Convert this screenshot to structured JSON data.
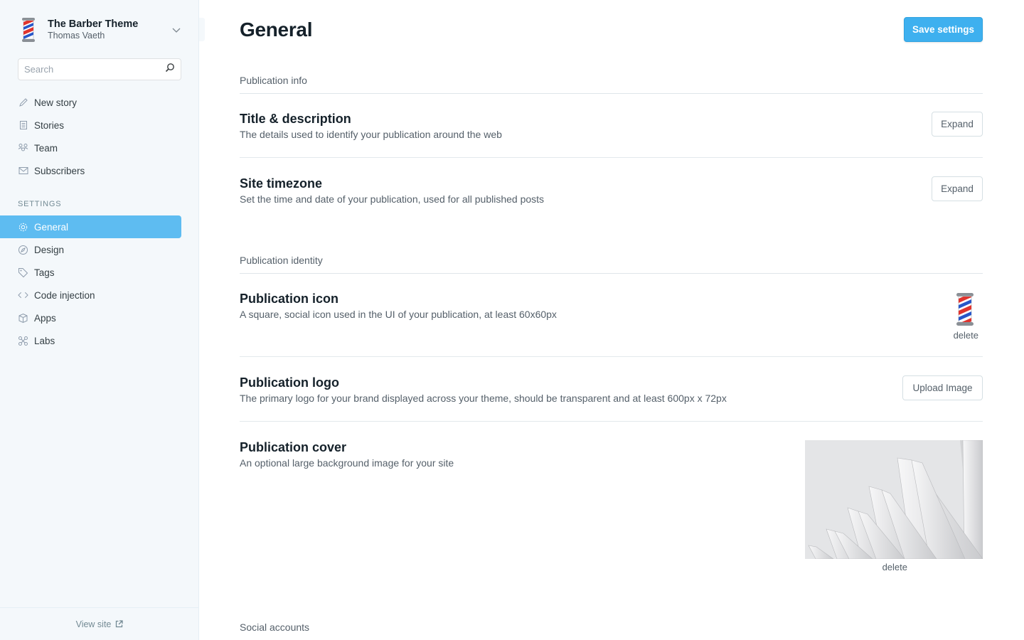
{
  "publication": {
    "title": "The Barber Theme",
    "user": "Thomas Vaeth"
  },
  "search": {
    "placeholder": "Search"
  },
  "nav": {
    "main": [
      {
        "label": "New story",
        "icon": "pencil-icon"
      },
      {
        "label": "Stories",
        "icon": "document-icon"
      },
      {
        "label": "Team",
        "icon": "team-icon"
      },
      {
        "label": "Subscribers",
        "icon": "mail-icon"
      }
    ],
    "settings_label": "SETTINGS",
    "settings": [
      {
        "label": "General",
        "icon": "gear-icon",
        "active": true
      },
      {
        "label": "Design",
        "icon": "compass-icon"
      },
      {
        "label": "Tags",
        "icon": "tag-icon"
      },
      {
        "label": "Code injection",
        "icon": "code-icon"
      },
      {
        "label": "Apps",
        "icon": "box-icon"
      },
      {
        "label": "Labs",
        "icon": "labs-icon"
      }
    ],
    "view_site": "View site"
  },
  "page": {
    "title": "General",
    "save_label": "Save settings"
  },
  "sections": {
    "info": {
      "heading": "Publication info",
      "title_desc": {
        "title": "Title & description",
        "desc": "The details used to identify your publication around the web",
        "button": "Expand"
      },
      "timezone": {
        "title": "Site timezone",
        "desc": "Set the time and date of your publication, used for all published posts",
        "button": "Expand"
      }
    },
    "identity": {
      "heading": "Publication identity",
      "icon": {
        "title": "Publication icon",
        "desc": "A square, social icon used in the UI of your publication, at least 60x60px",
        "delete": "delete"
      },
      "logo": {
        "title": "Publication logo",
        "desc": "The primary logo for your brand displayed across your theme, should be transparent and at least 600px x 72px",
        "button": "Upload Image"
      },
      "cover": {
        "title": "Publication cover",
        "desc": "An optional large background image for your site",
        "delete": "delete"
      }
    },
    "social": {
      "heading": "Social accounts"
    }
  },
  "colors": {
    "accent": "#3eb0ef",
    "active_nav": "#5ebcf1",
    "sidebar_bg": "#f4f8fb"
  }
}
